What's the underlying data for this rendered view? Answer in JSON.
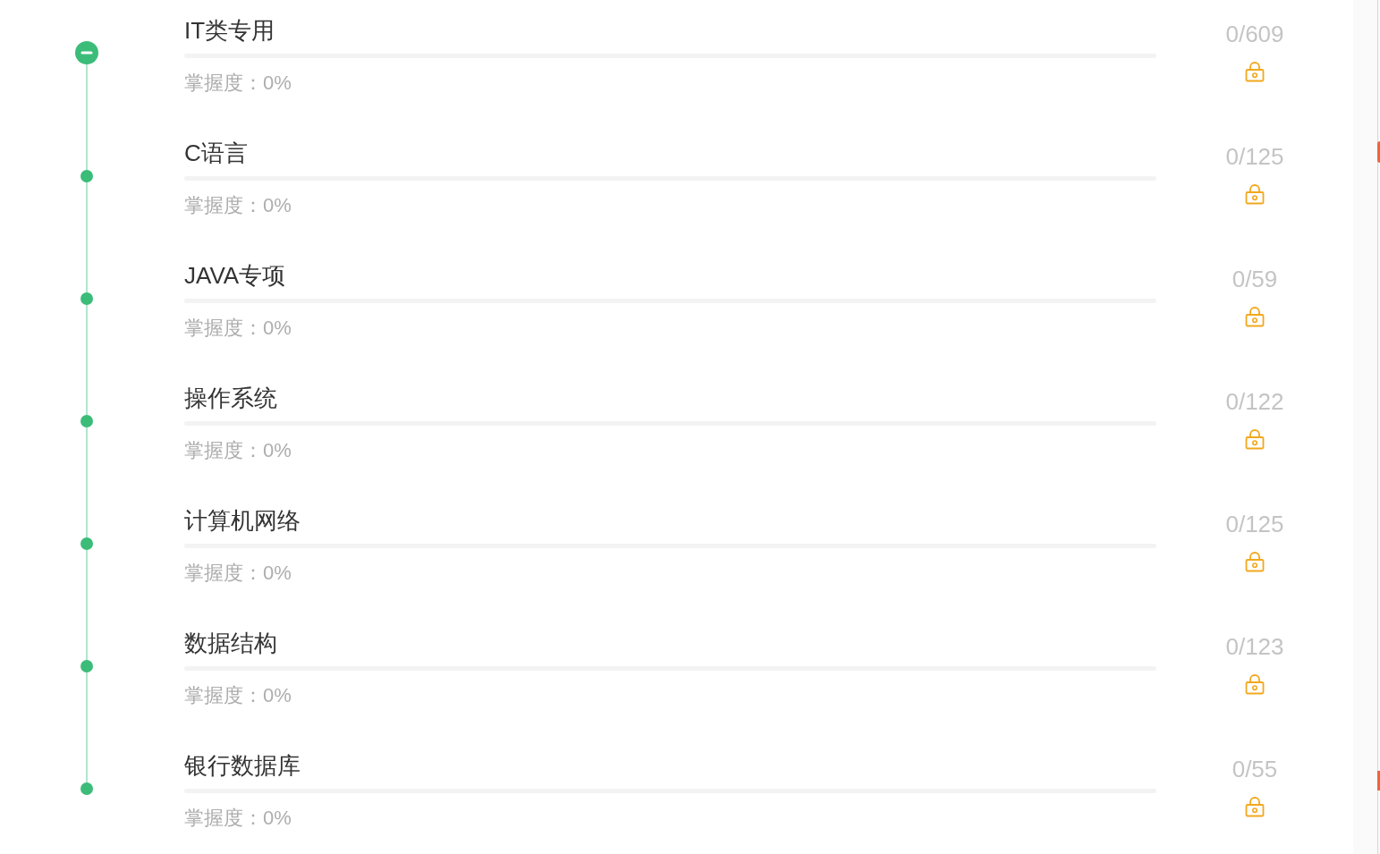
{
  "topics": [
    {
      "title": "IT类专用",
      "mastery": "掌握度：0%",
      "count": "0/609",
      "locked": true,
      "selected": true
    },
    {
      "title": "C语言",
      "mastery": "掌握度：0%",
      "count": "0/125",
      "locked": true,
      "selected": false
    },
    {
      "title": "JAVA专项",
      "mastery": "掌握度：0%",
      "count": "0/59",
      "locked": true,
      "selected": false
    },
    {
      "title": "操作系统",
      "mastery": "掌握度：0%",
      "count": "0/122",
      "locked": true,
      "selected": false
    },
    {
      "title": "计算机网络",
      "mastery": "掌握度：0%",
      "count": "0/125",
      "locked": true,
      "selected": false
    },
    {
      "title": "数据结构",
      "mastery": "掌握度：0%",
      "count": "0/123",
      "locked": true,
      "selected": false
    },
    {
      "title": "银行数据库",
      "mastery": "掌握度：0%",
      "count": "0/55",
      "locked": true,
      "selected": false
    }
  ]
}
